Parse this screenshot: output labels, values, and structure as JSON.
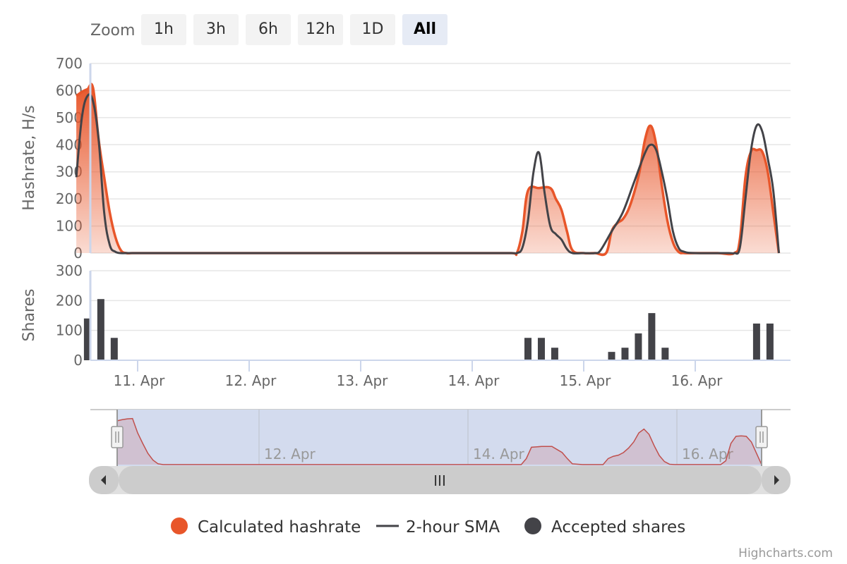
{
  "range_selector": {
    "label": "Zoom",
    "buttons": [
      "1h",
      "3h",
      "6h",
      "12h",
      "1D",
      "All"
    ],
    "selected": "All"
  },
  "colors": {
    "hashrate": "#e8562a",
    "sma": "#434348",
    "shares": "#434348",
    "navigator_mask": "#d3dbee",
    "navigator_series": "#c0504d",
    "scrollbar": "#cccccc",
    "axis_line": "#ccd6eb"
  },
  "legend": {
    "items": [
      {
        "name": "Calculated hashrate",
        "symbol": "circle",
        "color": "#e8562a"
      },
      {
        "name": "2-hour SMA",
        "symbol": "line",
        "color": "#434348"
      },
      {
        "name": "Accepted shares",
        "symbol": "circle",
        "color": "#434348"
      }
    ]
  },
  "credits": "Highcharts.com",
  "navigator": {
    "labels": [
      "12. Apr",
      "14. Apr",
      "16. Apr"
    ],
    "scrollbar_grip": "III"
  },
  "chart_data": [
    {
      "type": "area",
      "title": "",
      "ylabel": "Hashrate, H/s",
      "ylim": [
        0,
        700
      ],
      "yticks": [
        0,
        100,
        200,
        300,
        400,
        500,
        600,
        700
      ],
      "grid": true,
      "legend_position": "bottom",
      "series": [
        {
          "name": "Calculated hashrate",
          "type": "area",
          "x": [
            10.45,
            10.5,
            10.55,
            10.6,
            10.65,
            10.7,
            10.75,
            10.8,
            10.85,
            10.9,
            10.95,
            11.0,
            11.2,
            12.0,
            13.0,
            14.0,
            14.35,
            14.4,
            14.45,
            14.5,
            14.6,
            14.7,
            14.75,
            14.8,
            14.85,
            14.9,
            15.0,
            15.1,
            15.2,
            15.25,
            15.3,
            15.35,
            15.4,
            15.45,
            15.5,
            15.55,
            15.6,
            15.65,
            15.7,
            15.75,
            15.8,
            15.85,
            15.9,
            16.0,
            16.2,
            16.35,
            16.4,
            16.45,
            16.5,
            16.55,
            16.6,
            16.65,
            16.7,
            16.75
          ],
          "y": [
            580,
            595,
            605,
            610,
            420,
            280,
            150,
            60,
            10,
            0,
            0,
            0,
            0,
            0,
            0,
            0,
            0,
            0,
            80,
            230,
            240,
            240,
            200,
            160,
            80,
            10,
            0,
            0,
            0,
            80,
            110,
            125,
            160,
            220,
            300,
            420,
            470,
            400,
            250,
            120,
            40,
            5,
            0,
            0,
            0,
            0,
            50,
            280,
            375,
            380,
            375,
            300,
            150,
            0
          ]
        },
        {
          "name": "2-hour SMA",
          "type": "line",
          "x": [
            10.45,
            10.5,
            10.55,
            10.6,
            10.65,
            10.7,
            10.75,
            10.8,
            10.85,
            10.9,
            11.0,
            12.0,
            13.0,
            14.0,
            14.35,
            14.4,
            14.45,
            14.5,
            14.55,
            14.6,
            14.65,
            14.7,
            14.75,
            14.8,
            14.85,
            14.9,
            15.0,
            15.1,
            15.15,
            15.25,
            15.35,
            15.45,
            15.55,
            15.6,
            15.65,
            15.7,
            15.75,
            15.8,
            15.85,
            15.9,
            16.0,
            16.3,
            16.35,
            16.4,
            16.45,
            16.5,
            16.55,
            16.6,
            16.65,
            16.7,
            16.75
          ],
          "y": [
            280,
            500,
            580,
            560,
            420,
            150,
            30,
            5,
            0,
            0,
            0,
            0,
            0,
            0,
            0,
            0,
            20,
            120,
            300,
            370,
            220,
            100,
            70,
            50,
            15,
            0,
            0,
            0,
            10,
            80,
            150,
            260,
            370,
            400,
            380,
            300,
            200,
            80,
            20,
            5,
            0,
            0,
            0,
            20,
            200,
            380,
            470,
            450,
            350,
            230,
            0
          ]
        }
      ]
    },
    {
      "type": "bar",
      "title": "",
      "ylabel": "Shares",
      "ylim": [
        0,
        300
      ],
      "yticks": [
        0,
        100,
        200,
        300
      ],
      "grid": true,
      "series": [
        {
          "name": "Accepted shares",
          "x": [
            10.55,
            10.67,
            10.79,
            14.5,
            14.62,
            14.74,
            15.25,
            15.37,
            15.49,
            15.61,
            15.73,
            16.55,
            16.67
          ],
          "y": [
            140,
            205,
            75,
            75,
            75,
            42,
            28,
            42,
            90,
            158,
            42,
            123,
            123
          ]
        }
      ],
      "xlabels": [
        "11. Apr",
        "12. Apr",
        "13. Apr",
        "14. Apr",
        "15. Apr",
        "16. Apr"
      ],
      "xticks": [
        11,
        12,
        13,
        14,
        15,
        16
      ]
    }
  ]
}
